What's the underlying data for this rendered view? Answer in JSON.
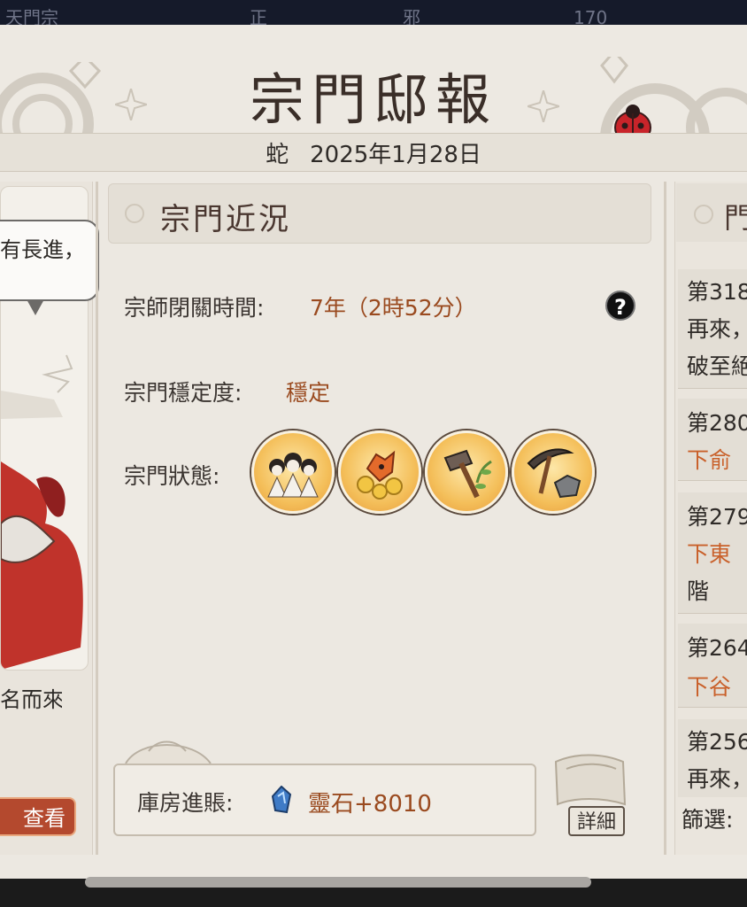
{
  "top_bar": {
    "left_text": "天門宗",
    "middle_left": "正",
    "middle_right": "邪",
    "resource_count": "170"
  },
  "header": {
    "title": "宗門邸報",
    "zodiac": "蛇",
    "date": "2025年1月28日"
  },
  "left_panel": {
    "speech_text": "有長進，",
    "caption": "名而來",
    "view_button": "查看"
  },
  "section": {
    "title": "宗門近況",
    "rows": [
      {
        "label": "宗師閉關時間:",
        "value": "7年（2時52分）"
      },
      {
        "label": "宗門穩定度:",
        "value": "穩定"
      },
      {
        "label": "宗門狀態:",
        "value": ""
      }
    ],
    "status_icons": [
      "disciples-icon",
      "treasure-beast-icon",
      "hammer-herb-icon",
      "pickaxe-ore-icon"
    ]
  },
  "ledger": {
    "label": "庫房進賬:",
    "resource_icon": "spirit-stone-icon",
    "value": "靈石+8010",
    "details_button": "詳細"
  },
  "right_panel": {
    "title": "門",
    "items": [
      {
        "lines": [
          "第318",
          "再來，",
          "破至絕"
        ]
      },
      {
        "lines": [
          "第280",
          "下俞",
          ""
        ]
      },
      {
        "lines": [
          "第279",
          "下東",
          "階"
        ]
      },
      {
        "lines": [
          "第264",
          "下谷",
          ""
        ]
      },
      {
        "lines": [
          "第256",
          "再來，",
          ""
        ]
      }
    ],
    "filter_label": "篩選:"
  },
  "colors": {
    "accent_value": "#9a4a1f",
    "link_orange": "#c9602a",
    "paper": "#ece8e1"
  }
}
